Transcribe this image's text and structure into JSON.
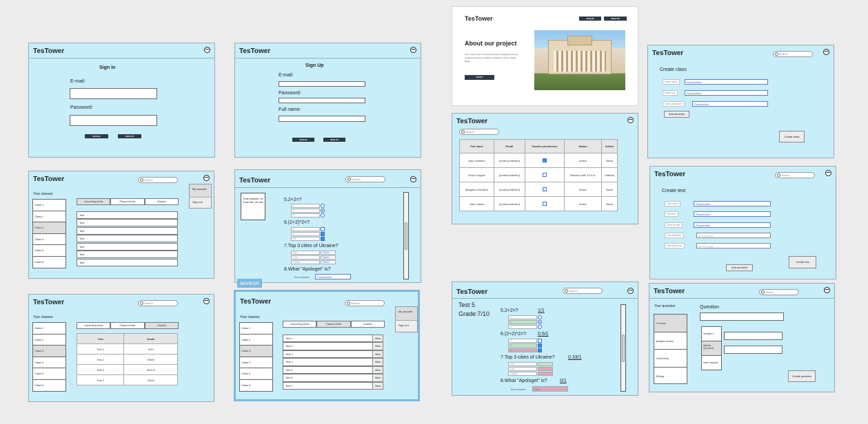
{
  "app": "TesTower",
  "search": "Search",
  "signin": {
    "title": "Sign in",
    "email": "E-mail:",
    "password": "Password:",
    "signin_btn": "SIGN IN",
    "signup_btn": "SIGN UP"
  },
  "signup": {
    "title": "Sign Up",
    "email": "E-mail:",
    "password": "Password:",
    "fullname": "Full name:",
    "signin_btn": "SIGN IN",
    "signup_btn": "SIGN UP"
  },
  "landing": {
    "signin_btn": "SIGN IN",
    "signup_btn": "SIGN UP",
    "title": "About our project",
    "body": "Lorem ipsum dolor sit amet consectetur adipiscing elit sed do eiusmod tempor incididunt ut labore et dolore magna aliqua",
    "start_btn": "START"
  },
  "classes": {
    "your_classes": "Your classes:",
    "items": [
      "Class 1",
      "Class 2",
      "Class 3",
      "Class 4",
      "Class 5",
      "Class 6"
    ],
    "tabs": [
      "Upcoming tests",
      "Passed tests",
      "Grades"
    ],
    "tests": [
      "Test",
      "Test",
      "Test",
      "Test",
      "Test",
      "Test",
      "Test"
    ],
    "menu": [
      "My account",
      "Sign out"
    ]
  },
  "grades": {
    "col_test": "Test",
    "col_grade": "Grade",
    "rows": [
      [
        "Test 1",
        "5/10"
      ],
      [
        "Test 2",
        "0/055"
      ],
      [
        "Test 3",
        "45/123"
      ],
      [
        "Test 4",
        "0/015"
      ]
    ]
  },
  "view_tests": {
    "items": [
      "Test 1",
      "Test 2",
      "Test 3",
      "Test 4",
      "Test 5",
      "Test 6",
      "Test 7"
    ],
    "view": "View"
  },
  "cursor_tag": "severyn",
  "quiz": {
    "timer": "Time passed: 1h\nTime left: 20 min",
    "q1": "5.2+2=?",
    "q2": "6.(2+2)*2=?",
    "q3": "7.Top 3 cities of Ukraine?",
    "q4": "8.What \"Apologet\" is?",
    "opts1": [
      "4",
      "5",
      "3"
    ],
    "opts2": [
      "4",
      "8",
      "16"
    ],
    "opts3": [
      "Kyiv",
      "Lviv",
      "Odesa"
    ],
    "select": "Select",
    "answer_label": "Your answer:",
    "answer_ph": "Placeholder"
  },
  "admin": {
    "headers": [
      "Full name",
      "Email",
      "Teacher permission",
      "Status",
      "Action"
    ],
    "rows": [
      [
        "Ada Lovelace",
        "[email protected]",
        "Active",
        "Block"
      ],
      [
        "Grace Hopper",
        "[email protected]",
        "Blocked until 10 d.m",
        "Unblock"
      ],
      [
        "Margaret Hamilton",
        "[email protected]",
        "Active",
        "Block"
      ],
      [
        "Joan Clarke",
        "[email protected]",
        "Active",
        "Block"
      ]
    ]
  },
  "result": {
    "title": "Test 5",
    "grade": "Grade:7/10",
    "s1": "1/1",
    "s2": "0.5/1",
    "s3": "0.33/1",
    "s4": "0/1",
    "answer": "Gate"
  },
  "create_class": {
    "title": "Create class",
    "labels": [
      "Class name:",
      "Class info:",
      "Class password:"
    ],
    "placeholder": "Placeholder",
    "add_students": "Add students",
    "create_btn": "Create class"
  },
  "create_test": {
    "title": "Create test",
    "labels": [
      "Test name:",
      "Test info:",
      "Time for test:",
      "Test deadline:",
      "Test start time:"
    ],
    "placeholder": "Placeholder",
    "date_ph": "dd.mm.yyyy",
    "add_question": "Add question",
    "create_btn": "Create test"
  },
  "question": {
    "your_question": "Your question",
    "question": "Question",
    "types": [
      "1 choice",
      "Multiple choice",
      "Conformity",
      "Writing"
    ],
    "variants": [
      "Variant 1",
      "Variant 2(correct)",
      "New variant"
    ],
    "create_btn": "Create question"
  }
}
